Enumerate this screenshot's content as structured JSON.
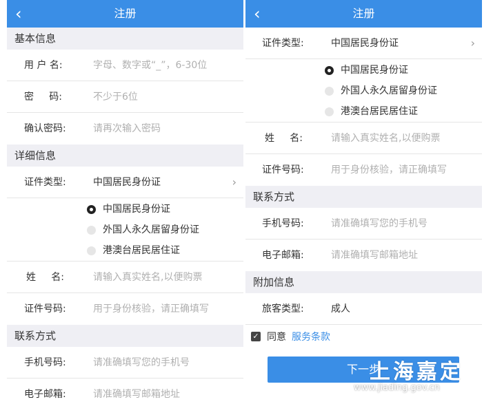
{
  "colors": {
    "accent": "#3a8ee6",
    "section_bg": "#efeff4",
    "placeholder": "#b0b0b0"
  },
  "left": {
    "back_icon": "chevron-left-icon",
    "title": "注册",
    "sections": {
      "basic": "基本信息",
      "detail": "详细信息",
      "contact": "联系方式"
    },
    "username": {
      "label": "用 户 名:",
      "placeholder": "字母、数字或“_”，6-30位"
    },
    "password": {
      "label": "密     码:",
      "placeholder": "不少于6位"
    },
    "confirm": {
      "label": "确认密码:",
      "placeholder": "请再次输入密码"
    },
    "id_type": {
      "label": "证件类型:",
      "value": "中国居民身份证",
      "chevron_icon": "chevron-right-icon"
    },
    "radios": [
      "中国居民身份证",
      "外国人永久居留身份证",
      "港澳台居民居住证"
    ],
    "name": {
      "label": "姓     名:",
      "placeholder": "请输入真实姓名,以便购票"
    },
    "id_no": {
      "label": "证件号码:",
      "placeholder": "用于身份核验，请正确填写"
    },
    "phone": {
      "label": "手机号码:",
      "placeholder": "请准确填写您的手机号"
    },
    "email": {
      "label": "电子邮箱:",
      "placeholder": "请准确填写邮箱地址"
    }
  },
  "right": {
    "back_icon": "chevron-left-icon",
    "title": "注册",
    "id_type": {
      "label": "证件类型:",
      "value": "中国居民身份证",
      "chevron_icon": "chevron-right-icon"
    },
    "radios": [
      "中国居民身份证",
      "外国人永久居留身份证",
      "港澳台居民居住证"
    ],
    "name": {
      "label": "姓     名:",
      "placeholder": "请输入真实姓名,以便购票"
    },
    "id_no": {
      "label": "证件号码:",
      "placeholder": "用于身份核验，请正确填写"
    },
    "sections": {
      "contact": "联系方式",
      "extra": "附加信息"
    },
    "phone": {
      "label": "手机号码:",
      "placeholder": "请准确填写您的手机号"
    },
    "email": {
      "label": "电子邮箱:",
      "placeholder": "请准确填写邮箱地址"
    },
    "passenger": {
      "label": "旅客类型:",
      "value": "成人"
    },
    "agree": {
      "text": "同意",
      "link": "服务条款",
      "checked": true
    },
    "next_button": "下一步"
  },
  "watermark": {
    "cn": "上海嘉定",
    "url": "www.jiading.gov.cn"
  }
}
